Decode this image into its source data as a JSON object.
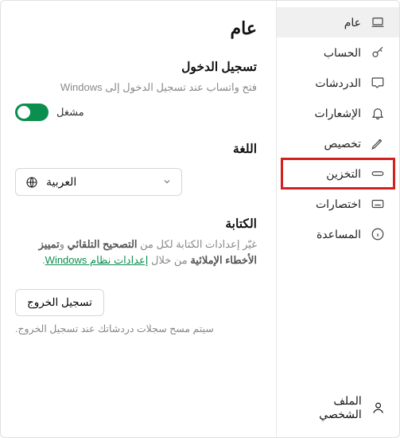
{
  "sidebar": {
    "items": [
      {
        "label": "عام"
      },
      {
        "label": "الحساب"
      },
      {
        "label": "الدردشات"
      },
      {
        "label": "الإشعارات"
      },
      {
        "label": "تخصيص"
      },
      {
        "label": "التخزين"
      },
      {
        "label": "اختصارات"
      },
      {
        "label": "المساعدة"
      }
    ],
    "profile_label": "الملف الشخصي"
  },
  "main": {
    "title": "عام",
    "login": {
      "heading": "تسجيل الدخول",
      "desc": "فتح واتساب عند تسجيل الدخول إلى Windows",
      "toggle_label": "مشغل",
      "enabled": true
    },
    "language": {
      "heading": "اللغة",
      "selected": "العربية"
    },
    "typing": {
      "heading": "الكتابة",
      "desc_part1": "غيّر إعدادات الكتابة لكل من ",
      "bold1": "التصحيح التلقائي",
      "desc_part2": " و",
      "bold2": "تمييز الأخطاء الإملائية",
      "desc_part3": " من خلال ",
      "link_text": "إعدادات نظام Windows",
      "desc_part4": "."
    },
    "logout": {
      "button": "تسجيل الخروج",
      "note": "سيتم مسح سجلات دردشاتك عند تسجيل الخروج."
    }
  }
}
